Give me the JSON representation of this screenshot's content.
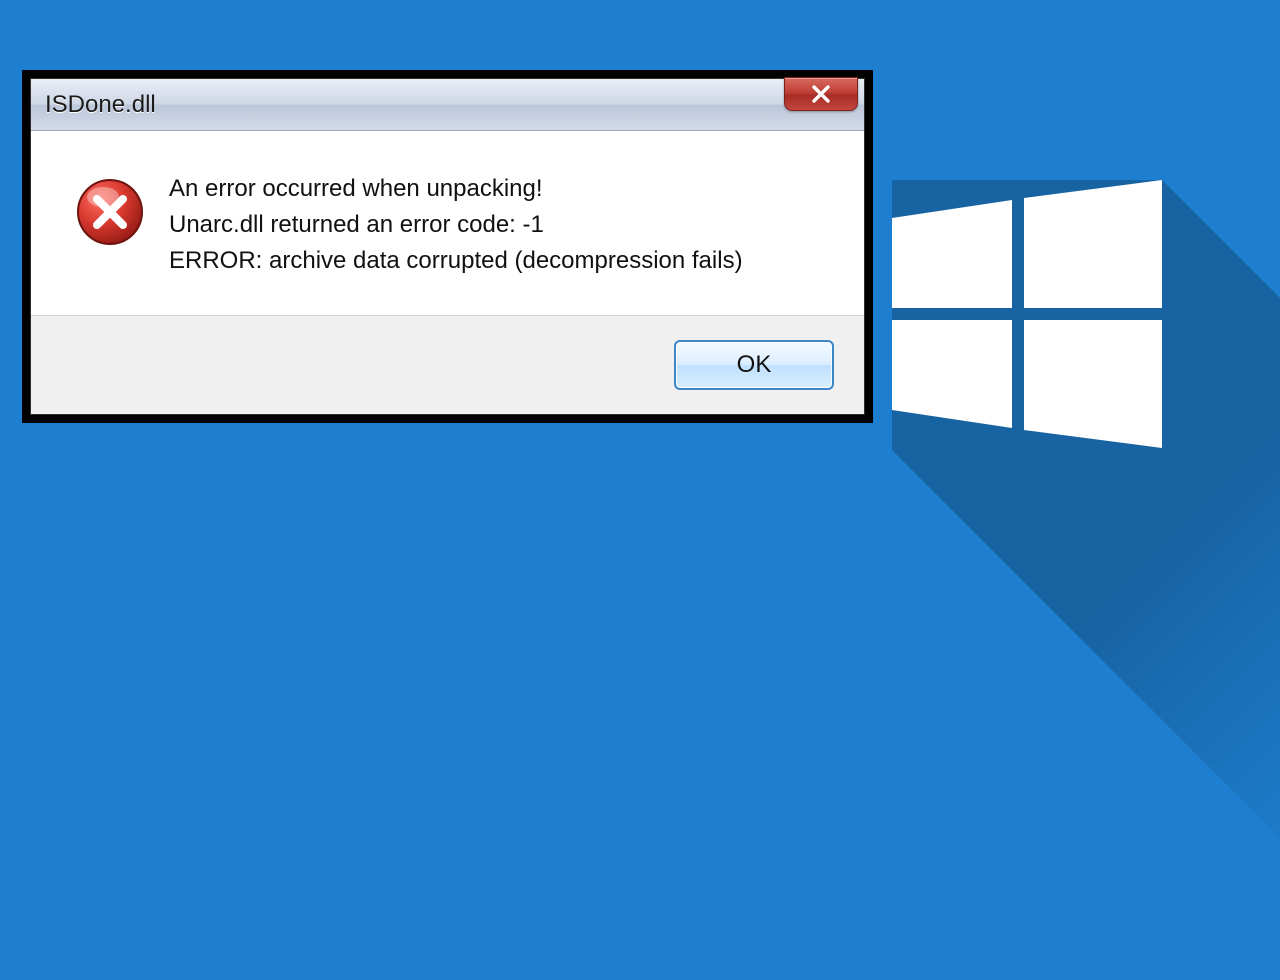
{
  "dialog": {
    "title": "ISDone.dll",
    "message_line1": "An error occurred when unpacking!",
    "message_line2": "Unarc.dll returned an error code: -1",
    "message_line3": "ERROR: archive data corrupted (decompression fails)",
    "ok_label": "OK"
  },
  "colors": {
    "background": "#1e7fd0",
    "close_button": "#be3f36",
    "ok_border": "#3d87c9"
  }
}
